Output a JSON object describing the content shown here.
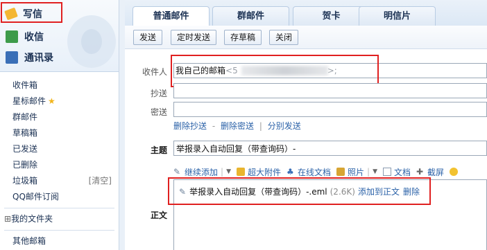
{
  "sidebar": {
    "write_label": "写信",
    "inbox_label": "收信",
    "contacts_label": "通讯录",
    "folders": [
      {
        "label": "收件箱"
      },
      {
        "label": "星标邮件"
      },
      {
        "label": "群邮件"
      },
      {
        "label": "草稿箱"
      },
      {
        "label": "已发送"
      },
      {
        "label": "已删除"
      },
      {
        "label": "垃圾箱",
        "action": "[清空]"
      },
      {
        "label": "QQ邮件订阅"
      }
    ],
    "my_folders": "我的文件夹",
    "other_mailbox": "其他邮箱"
  },
  "tabs": [
    {
      "label": "普通邮件",
      "active": true
    },
    {
      "label": "群邮件"
    },
    {
      "label": "贺卡"
    },
    {
      "label": "明信片"
    }
  ],
  "toolbar": {
    "send": "发送",
    "scheduled_send": "定时发送",
    "save_draft": "存草稿",
    "close": "关闭"
  },
  "compose": {
    "to_label": "收件人",
    "to_name": "我自己的邮箱",
    "to_addr_prefix": "<5",
    "to_addr_suffix": ">;",
    "cc_label": "抄送",
    "bcc_label": "密送",
    "link_delete_cc": "删除抄送",
    "link_delete_bcc": "删除密送",
    "link_separate": "分别发送",
    "link_sep": "-",
    "bar": "|",
    "subject_label": "主题",
    "subject_value": "举报录入自动回复（带查询码）-",
    "body_label": "正文"
  },
  "attach_toolbar": {
    "continue_add": "继续添加",
    "large_attach": "超大附件",
    "online_doc": "在线文档",
    "photo": "照片",
    "document": "文档",
    "screenshot": "截屏"
  },
  "attachment": {
    "filename": "举报录入自动回复（带查询码）-.eml",
    "size": "(2.6K)",
    "add_to_body": "添加到正文",
    "delete": "删除"
  },
  "colors": {
    "highlight": "#e02020",
    "link": "#2b62a8",
    "star": "#f2b51c"
  }
}
